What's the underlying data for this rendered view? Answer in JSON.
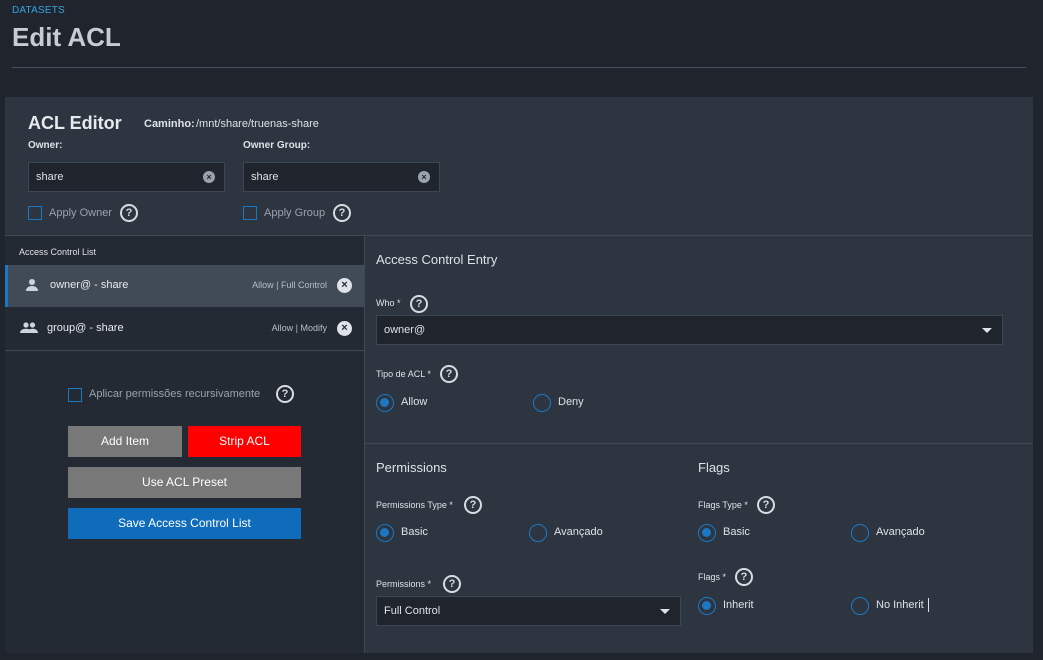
{
  "header": {
    "breadcrumb": "DATASETS",
    "title": "Edit ACL"
  },
  "editor": {
    "title": "ACL Editor",
    "path_label": "Caminho:",
    "path_value": "/mnt/share/truenas-share",
    "owner_label": "Owner:",
    "owner_value": "share",
    "owner_group_label": "Owner Group:",
    "owner_group_value": "share",
    "apply_owner_label": "Apply Owner",
    "apply_group_label": "Apply Group"
  },
  "acl_list": {
    "title": "Access Control List",
    "items": [
      {
        "name": "owner@ - share",
        "detail": "Allow | Full Control",
        "icon": "person-icon"
      },
      {
        "name": "group@ - share",
        "detail": "Allow | Modify",
        "icon": "group-icon"
      }
    ],
    "recursive_label": "Aplicar permissões recursivamente"
  },
  "buttons": {
    "add_item": "Add Item",
    "strip_acl": "Strip ACL",
    "use_preset": "Use ACL Preset",
    "save": "Save Access Control List"
  },
  "entry": {
    "title": "Access Control Entry",
    "who_label": "Who *",
    "who_value": "owner@",
    "acl_type_label": "Tipo de ACL *",
    "acl_type_options": [
      "Allow",
      "Deny"
    ],
    "permissions_title": "Permissions",
    "permissions_type_label": "Permissions Type *",
    "permissions_type_options": [
      "Basic",
      "Avançado"
    ],
    "permissions_label": "Permissions *",
    "permissions_value": "Full Control",
    "flags_title": "Flags",
    "flags_type_label": "Flags Type *",
    "flags_type_options": [
      "Basic",
      "Avançado"
    ],
    "flags_label": "Flags *",
    "flags_options": [
      "Inherit",
      "No Inherit"
    ]
  },
  "colors": {
    "accent": "#1d78c4",
    "danger": "#ff0000",
    "primary": "#0e6cba",
    "neutral": "#787878"
  }
}
